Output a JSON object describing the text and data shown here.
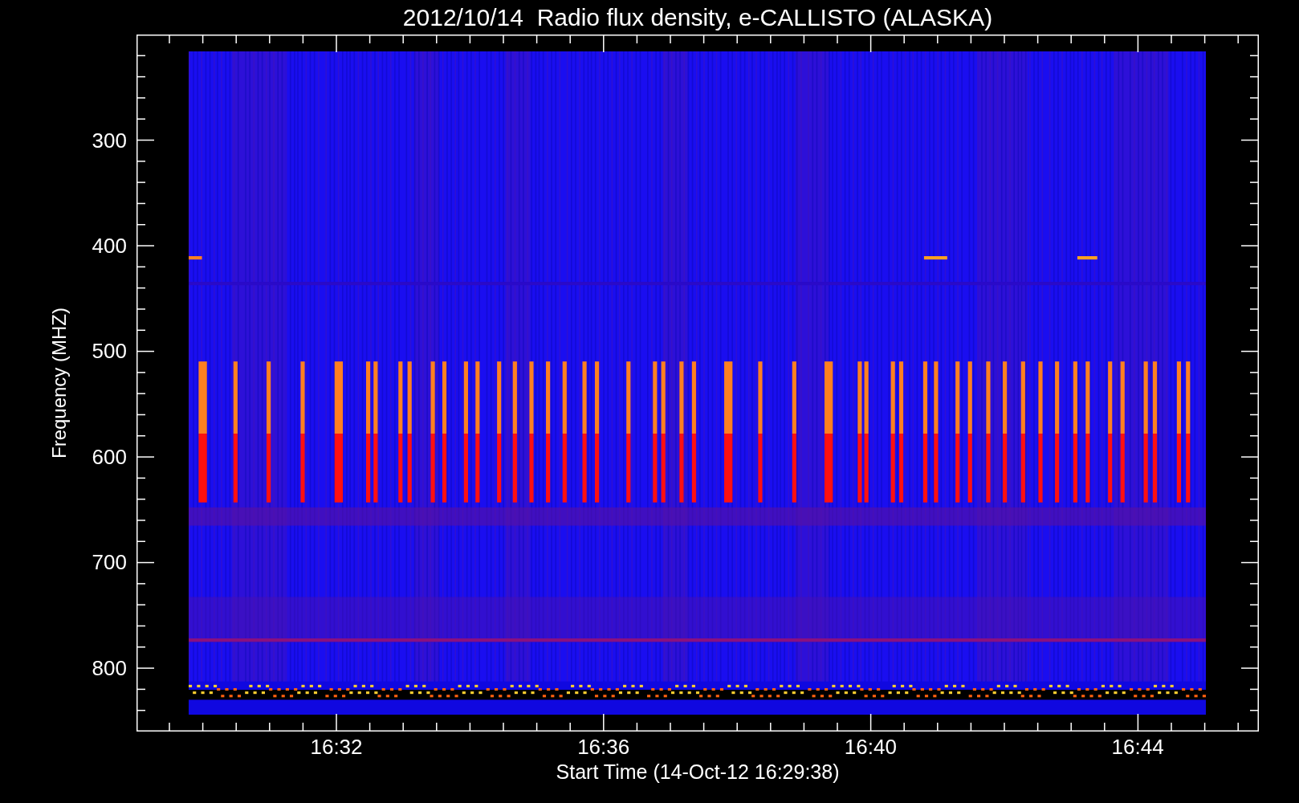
{
  "title": "2012/10/14  Radio flux density, e-CALLISTO (ALASKA)",
  "y_axis": {
    "label": "Frequency (MHZ)",
    "ticks": [
      "300",
      "400",
      "500",
      "600",
      "700",
      "800"
    ]
  },
  "x_axis": {
    "label": "Start Time (14-Oct-12 16:29:38)",
    "ticks": [
      "16:32",
      "16:36",
      "16:40",
      "16:44"
    ]
  }
}
